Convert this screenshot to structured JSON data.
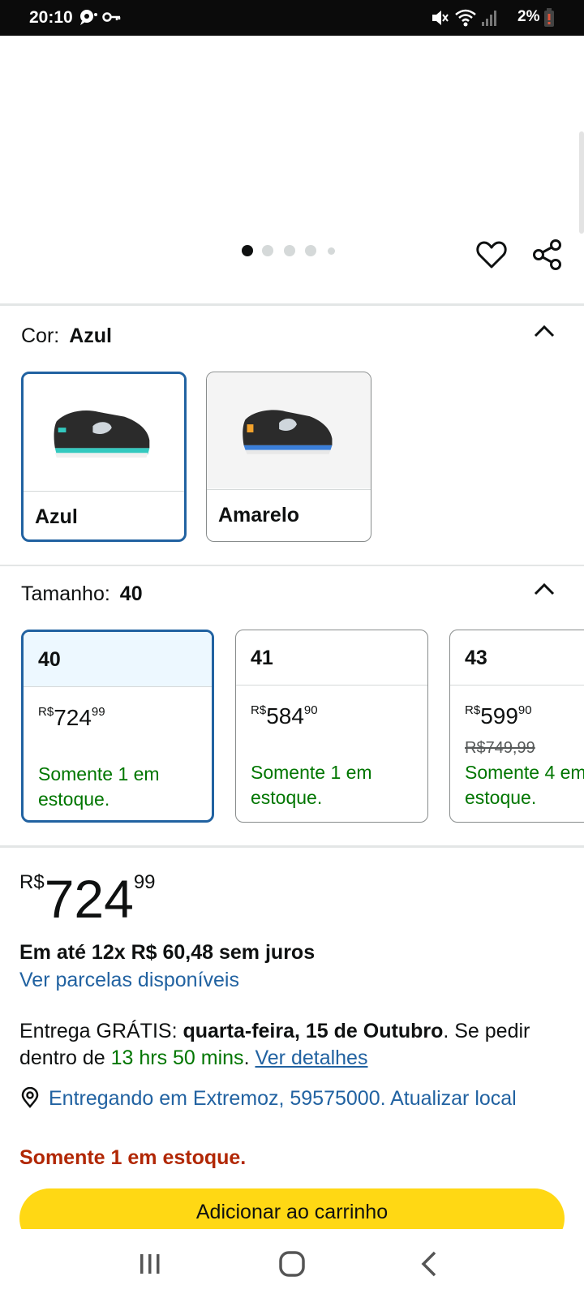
{
  "status_bar": {
    "time": "20:10",
    "battery": "2%",
    "icons": [
      "chat-notification-icon",
      "key-icon",
      "mute-icon",
      "wifi-icon",
      "signal-icon",
      "battery-icon"
    ]
  },
  "gallery": {
    "pages": 5,
    "current_page": 1,
    "icons": [
      "heart-icon",
      "share-icon"
    ]
  },
  "color": {
    "label": "Cor:",
    "selected": "Azul",
    "options": [
      {
        "name": "Azul",
        "selected": true
      },
      {
        "name": "Amarelo",
        "selected": false
      }
    ]
  },
  "size": {
    "label": "Tamanho:",
    "selected": "40",
    "options": [
      {
        "size": "40",
        "currency": "R$",
        "whole": "724",
        "cents": "99",
        "list_price": "",
        "stock_line1": "Somente 1 em",
        "stock_line2": "estoque.",
        "selected": true
      },
      {
        "size": "41",
        "currency": "R$",
        "whole": "584",
        "cents": "90",
        "list_price": "",
        "stock_line1": "Somente 1 em",
        "stock_line2": "estoque.",
        "selected": false
      },
      {
        "size": "43",
        "currency": "R$",
        "whole": "599",
        "cents": "90",
        "list_price": "R$749,99",
        "stock_line1": "Somente 4 em",
        "stock_line2": "estoque.",
        "selected": false
      }
    ]
  },
  "price": {
    "currency": "R$",
    "whole": "724",
    "cents": "99",
    "installments": "Em até 12x R$ 60,48 sem juros",
    "installments_link": "Ver parcelas disponíveis"
  },
  "delivery": {
    "prefix": "Entrega GRÁTIS: ",
    "date": "quarta-feira, 15 de Outubro",
    "middle": ". Se pedir dentro de ",
    "countdown": "13 hrs 50 mins",
    "sep": ". ",
    "details_link": "Ver detalhes"
  },
  "location": {
    "text": "Entregando em Extremoz, 59575000. Atualizar local"
  },
  "stock": "Somente 1 em estoque.",
  "cart_button": "Adicionar ao carrinho",
  "colors": {
    "accent_blue": "#2162a1",
    "stock_green": "#007600",
    "stock_red": "#b12704",
    "cart_yellow": "#ffd814"
  }
}
